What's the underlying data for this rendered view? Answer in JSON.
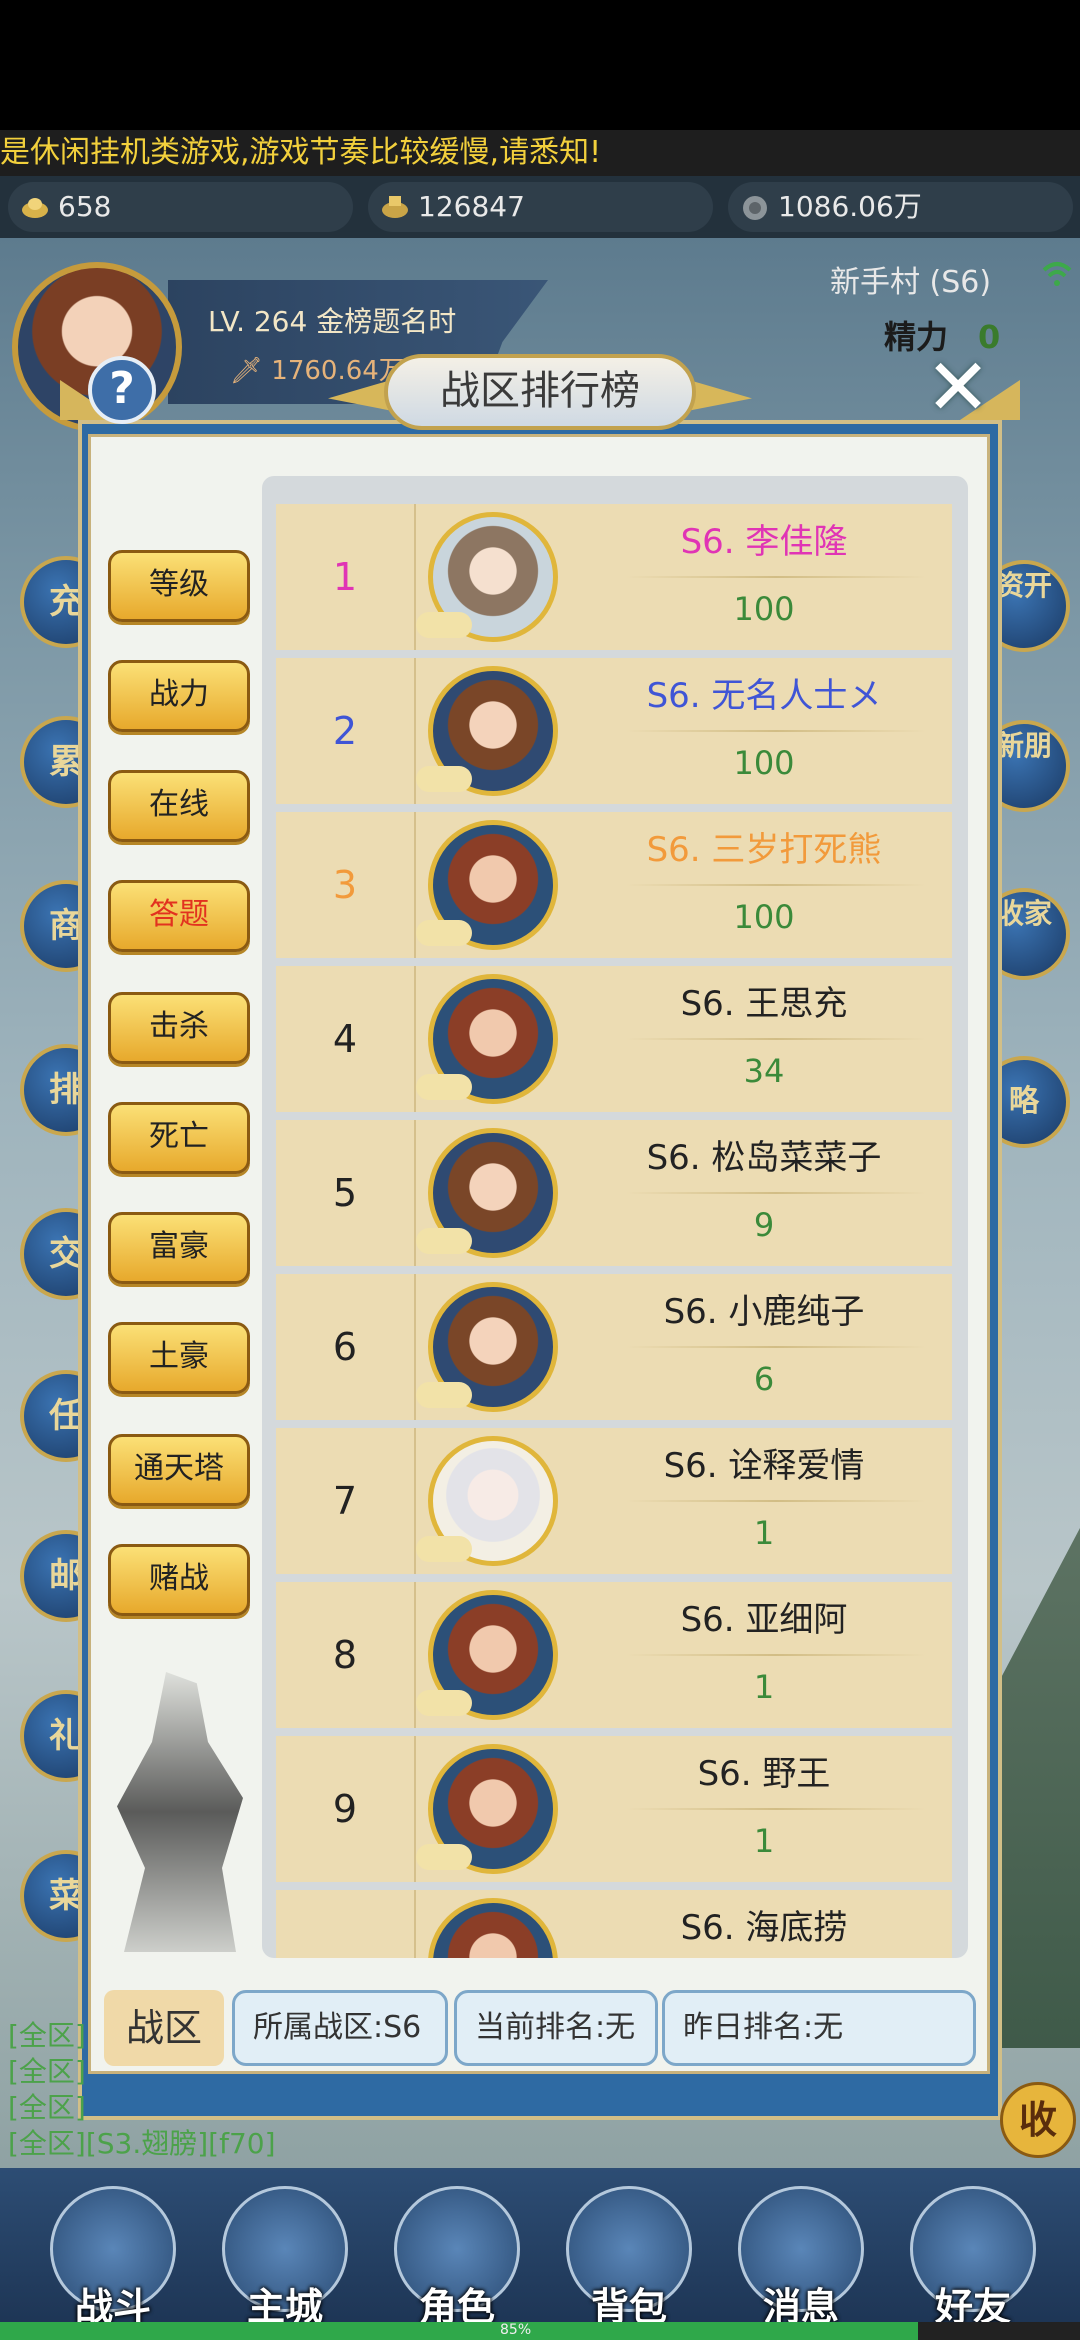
{
  "marquee": "是休闲挂机类游戏,游戏节奏比较缓慢,请悉知!",
  "resources": [
    {
      "icon": "gold-ingot-icon",
      "value": "658"
    },
    {
      "icon": "silver-ingot-icon",
      "value": "126847"
    },
    {
      "icon": "coin-pouch-icon",
      "value": "1086.06万"
    }
  ],
  "player": {
    "level_title": "LV. 264 金榜题名时",
    "power": "1760.64万"
  },
  "region": "新手村 (S6)",
  "stamina": {
    "label": "精力",
    "value": "0"
  },
  "side_buttons_left": [
    "充",
    "累",
    "商",
    "排",
    "交",
    "任",
    "邮",
    "礼",
    "菜"
  ],
  "side_buttons_right": [
    "资开",
    "新朋",
    "收家",
    "略"
  ],
  "dialog": {
    "title": "战区排行榜",
    "help": "?",
    "categories": [
      "等级",
      "战力",
      "在线",
      "答题",
      "击杀",
      "死亡",
      "富豪",
      "土豪",
      "通天塔",
      "赌战"
    ],
    "active_category": "答题",
    "ranking": [
      {
        "rank": "1",
        "name": "S6. 李佳隆",
        "score": "100"
      },
      {
        "rank": "2",
        "name": "S6. 无名人士メ",
        "score": "100"
      },
      {
        "rank": "3",
        "name": "S6. 三岁打死熊",
        "score": "100"
      },
      {
        "rank": "4",
        "name": "S6. 王思充",
        "score": "34"
      },
      {
        "rank": "5",
        "name": "S6. 松岛菜菜子",
        "score": "9"
      },
      {
        "rank": "6",
        "name": "S6. 小鹿纯子",
        "score": "6"
      },
      {
        "rank": "7",
        "name": "S6. 诠释爱情",
        "score": "1"
      },
      {
        "rank": "8",
        "name": "S6. 亚细阿",
        "score": "1"
      },
      {
        "rank": "9",
        "name": "S6. 野王",
        "score": "1"
      },
      {
        "rank": "",
        "name": "S6. 海底捞",
        "score": ""
      }
    ],
    "zone_tag": "战区",
    "zone_info": "所属战区:S6",
    "current_rank": "当前排名:无",
    "yesterday_rank": "昨日排名:无"
  },
  "chat": [
    "[全区]",
    "[全区]",
    "[全区]",
    "[全区][S3.翅膀][f70]"
  ],
  "collapse_btn": "收",
  "bottom_nav": [
    "战斗",
    "主城",
    "角色",
    "背包",
    "消息",
    "好友"
  ],
  "loading": {
    "percent": 85,
    "label": "85%"
  },
  "colors": {
    "gold": "#e7b53c",
    "rank1": "#e034b5",
    "rank2": "#3f55d6",
    "rank3": "#f29a3b",
    "score": "#3b8a3a"
  }
}
